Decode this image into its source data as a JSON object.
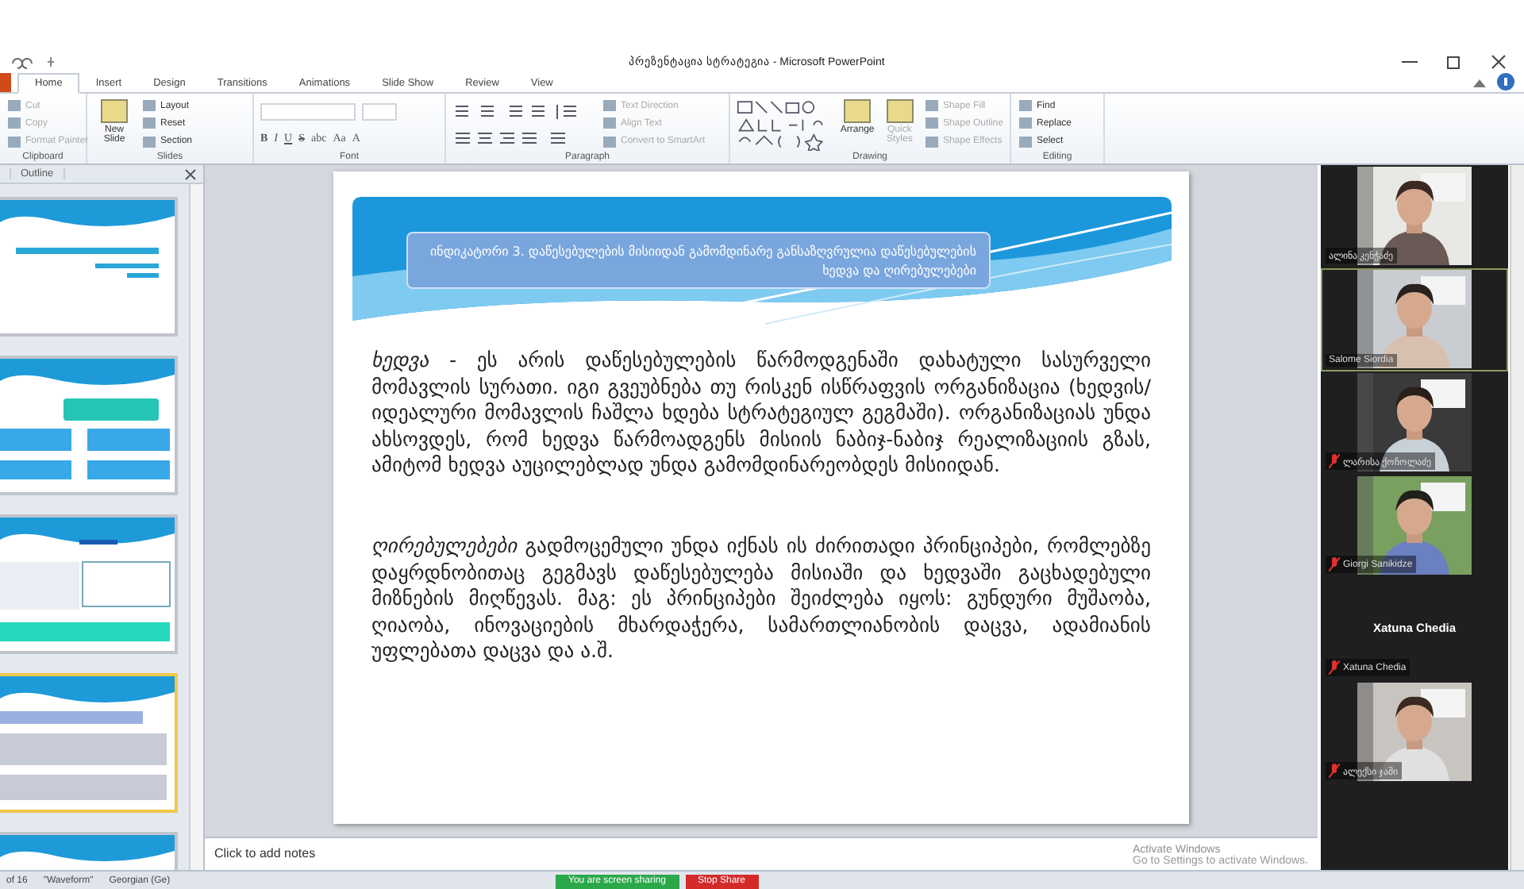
{
  "window": {
    "title": "პრეზენტაცია სტრატეგია - Microsoft PowerPoint"
  },
  "ribbon": {
    "tabs": [
      {
        "label": "Home",
        "selected": true
      },
      {
        "label": "Insert",
        "selected": false
      },
      {
        "label": "Design",
        "selected": false
      },
      {
        "label": "Transitions",
        "selected": false
      },
      {
        "label": "Animations",
        "selected": false
      },
      {
        "label": "Slide Show",
        "selected": false
      },
      {
        "label": "Review",
        "selected": false
      },
      {
        "label": "View",
        "selected": false
      }
    ],
    "groups": [
      {
        "kind": "clipboard",
        "label": "Clipboard",
        "items": [
          "Cut",
          "Copy",
          "Format Painter"
        ]
      },
      {
        "kind": "slides",
        "label": "Slides",
        "big": "New Slide",
        "items": [
          "Layout",
          "Reset",
          "Section"
        ]
      },
      {
        "kind": "font",
        "label": "Font",
        "items": [
          "B",
          "I",
          "U",
          "S",
          "abc",
          "Aa",
          "A"
        ]
      },
      {
        "kind": "paragraph",
        "label": "Paragraph",
        "items": [
          "Text Direction",
          "Align Text",
          "Convert to SmartArt"
        ]
      },
      {
        "kind": "drawing",
        "label": "Drawing",
        "big": "Arrange",
        "items": [
          "Quick Styles"
        ],
        "small": [
          "Shape Fill",
          "Shape Outline",
          "Shape Effects"
        ]
      },
      {
        "kind": "editing",
        "label": "Editing",
        "items": [
          "Find",
          "Replace",
          "Select"
        ]
      }
    ]
  },
  "slides_pane": {
    "tabs": [
      {
        "label": "Outline",
        "selected": false
      }
    ],
    "thumbnails": [
      {
        "selected": false
      },
      {
        "selected": false
      },
      {
        "selected": false
      },
      {
        "selected": true
      },
      {
        "selected": false
      }
    ]
  },
  "slide": {
    "heading": "ინდიკატორი 3. დაწესებულების მისიიდან გამომდინარე განსაზღვრულია დაწესებულების ხედვა და ღირებულებები",
    "paragraphs": [
      "*ხედვა* - ეს არის დაწესებულების წარმოდგენაში დახატული სასურველი მომავლის სურათი. იგი გვეუბნება თუ რისკენ ისწრაფვის ორგანიზაცია (ხედვის/იდეალური მომავლის ჩაშლა ხდება სტრატეგიულ გეგმაში). ორგანიზაციას უნდა ახსოვდეს, რომ ხედვა წარმოადგენს მისიის ნაბიჯ-ნაბიჯ რეალიზაციის გზას, ამიტომ ხედვა აუცილებლად უნდა გამომდინარეობდეს მისიიდან.",
      "*ღირებულებები* გადმოცემული უნდა იქნას ის ძირითადი პრინციპები, რომლებზე დაყრდნობითაც გეგმავს დაწესებულება მისიაში და ხედვაში გაცხადებული მიზნების მიღწევას. მაგ: ეს პრინციპები შეიძლება იყოს: გუნდური მუშაობა, ღიაობა, ინოვაციების მხარდაჭერა, სამართლიანობის დაცვა, ადამიანის უფლებათა დაცვა და ა.შ."
    ]
  },
  "notes": {
    "placeholder": "Click to add notes"
  },
  "participants": [
    {
      "kind": "video",
      "name": "ალინა კენჭაძე",
      "muted": false,
      "active": false
    },
    {
      "kind": "video",
      "name": "Salome Siordia",
      "muted": false,
      "active": true
    },
    {
      "kind": "video",
      "name": "ლარისა ქოჩოლაძე",
      "muted": true,
      "active": false
    },
    {
      "kind": "video",
      "name": "Giorgi Sanikidze",
      "muted": true,
      "active": false
    },
    {
      "kind": "name",
      "name": "Xatuna Chedia",
      "display": "Xatuna Chedia",
      "muted": true,
      "active": false
    },
    {
      "kind": "video",
      "name": "ალექსი ჯაში",
      "muted": true,
      "active": false
    }
  ],
  "activation": {
    "title": "Activate Windows",
    "text": "Go to Settings to activate Windows."
  },
  "status_bar": {
    "items": [
      "of 16",
      "\"Waveform\"",
      "Georgian (Ge)"
    ]
  },
  "share_bar": {
    "status": "You are screen sharing",
    "stop": "Stop Share"
  }
}
